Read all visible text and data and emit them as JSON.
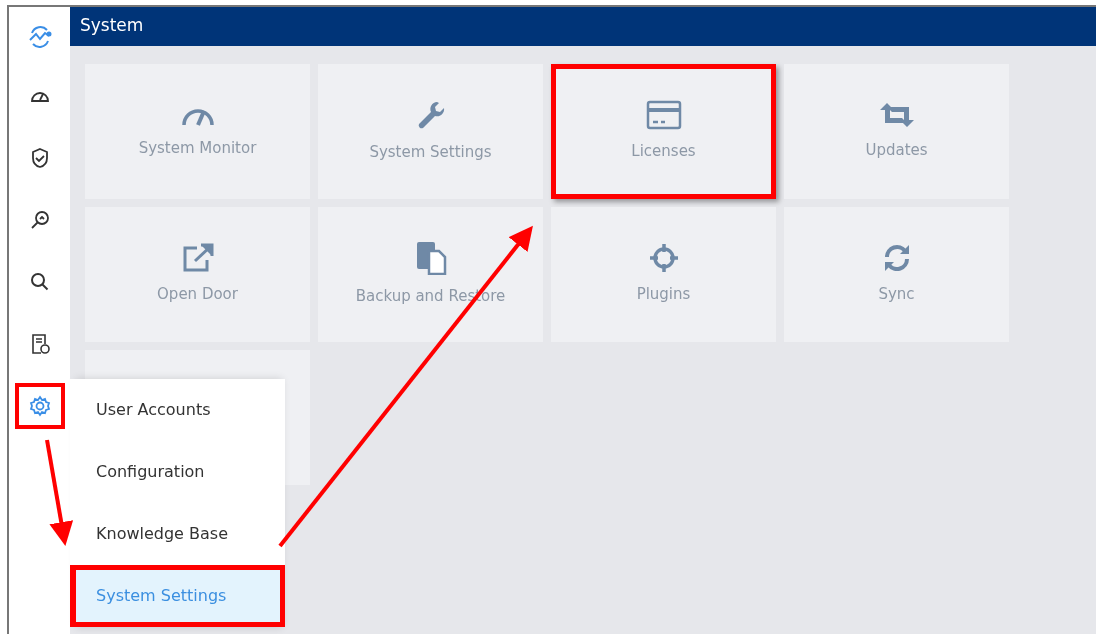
{
  "header": {
    "title": "System"
  },
  "sidebar": {
    "items": [
      {
        "selected": false,
        "highlighted": false
      },
      {
        "selected": false,
        "highlighted": false
      },
      {
        "selected": false,
        "highlighted": false
      },
      {
        "selected": false,
        "highlighted": false
      },
      {
        "selected": false,
        "highlighted": false
      },
      {
        "selected": true,
        "highlighted": true
      }
    ]
  },
  "tiles": [
    {
      "kind": "tile",
      "label": "System Monitor",
      "highlighted": false
    },
    {
      "kind": "tile",
      "label": "System Settings",
      "highlighted": false
    },
    {
      "kind": "tile",
      "label": "Licenses",
      "highlighted": true
    },
    {
      "kind": "tile",
      "label": "Updates",
      "highlighted": false
    },
    {
      "kind": "tile",
      "label": "Open Door",
      "highlighted": false
    },
    {
      "kind": "tile",
      "label": "Backup and Restore",
      "highlighted": false
    },
    {
      "kind": "tile",
      "label": "Plugins",
      "highlighted": false
    },
    {
      "kind": "tile",
      "label": "Sync",
      "highlighted": false
    },
    {
      "kind": "empty",
      "highlighted": false
    }
  ],
  "menu": {
    "items": [
      {
        "label": "User Accounts",
        "selected": false,
        "highlighted": false
      },
      {
        "label": "Configuration",
        "selected": false,
        "highlighted": false
      },
      {
        "label": "Knowledge Base",
        "selected": false,
        "highlighted": false
      },
      {
        "label": "System Settings",
        "selected": true,
        "highlighted": true
      }
    ]
  }
}
